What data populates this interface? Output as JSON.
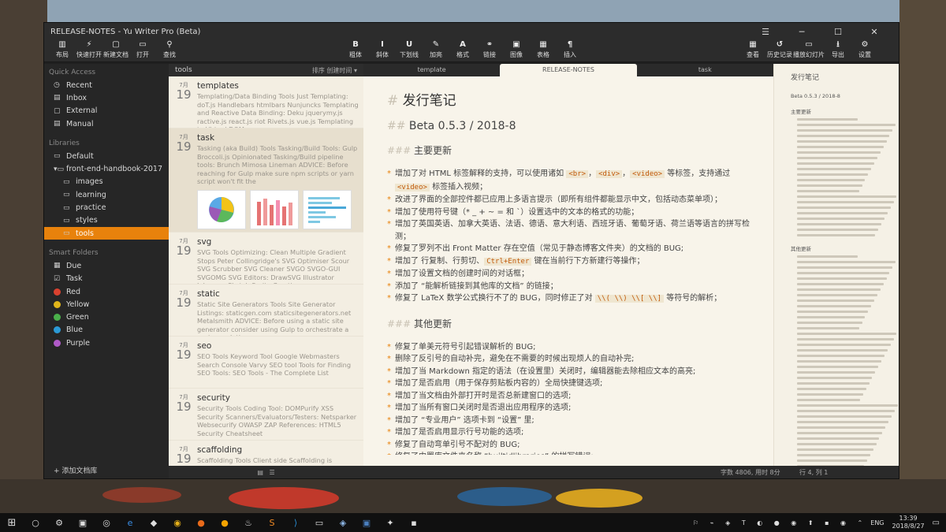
{
  "window": {
    "title": "RELEASE-NOTES - Yu Writer Pro (Beta)"
  },
  "toolbar": {
    "left": [
      {
        "icon": "layout-icon",
        "glyph": "▥",
        "label": "布局"
      },
      {
        "icon": "lightning-icon",
        "glyph": "⚡",
        "label": "快速打开"
      },
      {
        "icon": "new-doc-icon",
        "glyph": "▢",
        "label": "新建文档"
      },
      {
        "icon": "folder-icon",
        "glyph": "▭",
        "label": "打开"
      },
      {
        "icon": "search-icon",
        "glyph": "⚲",
        "label": "查找"
      }
    ],
    "center": [
      {
        "icon": "bold-icon",
        "glyph": "B",
        "label": "粗体"
      },
      {
        "icon": "italic-icon",
        "glyph": "I",
        "label": "斜体"
      },
      {
        "icon": "underline-icon",
        "glyph": "U",
        "label": "下划线"
      },
      {
        "icon": "brush-icon",
        "glyph": "✎",
        "label": "加亮"
      },
      {
        "icon": "format-icon",
        "glyph": "A",
        "label": "格式"
      },
      {
        "icon": "link-icon",
        "glyph": "⚭",
        "label": "链接"
      },
      {
        "icon": "image-icon",
        "glyph": "▣",
        "label": "图像"
      },
      {
        "icon": "table-icon",
        "glyph": "▦",
        "label": "表格"
      },
      {
        "icon": "paragraph-icon",
        "glyph": "¶",
        "label": "插入"
      }
    ],
    "right": [
      {
        "icon": "view-icon",
        "glyph": "▦",
        "label": "查看"
      },
      {
        "icon": "history-icon",
        "glyph": "↺",
        "label": "历史记录"
      },
      {
        "icon": "slides-icon",
        "glyph": "▭",
        "label": "播放幻灯片"
      },
      {
        "icon": "export-icon",
        "glyph": "⭳",
        "label": "导出"
      },
      {
        "icon": "gear-icon",
        "glyph": "⚙",
        "label": "设置"
      }
    ]
  },
  "sidebar": {
    "quick_access_title": "Quick Access",
    "quick": [
      {
        "icon": "clock-icon",
        "glyph": "◷",
        "label": "Recent"
      },
      {
        "icon": "inbox-icon",
        "glyph": "▤",
        "label": "Inbox"
      },
      {
        "icon": "external-icon",
        "glyph": "▢",
        "label": "External"
      },
      {
        "icon": "manual-icon",
        "glyph": "▤",
        "label": "Manual"
      }
    ],
    "libraries_title": "Libraries",
    "libs": [
      {
        "label": "Default",
        "sub": false,
        "active": false
      },
      {
        "label": "front-end-handbook-2017",
        "sub": false,
        "active": false
      },
      {
        "label": "images",
        "sub": true,
        "active": false
      },
      {
        "label": "learning",
        "sub": true,
        "active": false
      },
      {
        "label": "practice",
        "sub": true,
        "active": false
      },
      {
        "label": "styles",
        "sub": true,
        "active": false
      },
      {
        "label": "tools",
        "sub": true,
        "active": true
      }
    ],
    "smart_title": "Smart Folders",
    "smart": [
      {
        "label": "Due",
        "glyph": "▦"
      },
      {
        "label": "Task",
        "glyph": "☑"
      }
    ],
    "colors": [
      {
        "label": "Red",
        "color": "#d9412f"
      },
      {
        "label": "Yellow",
        "color": "#e0b51a"
      },
      {
        "label": "Green",
        "color": "#4ab04a"
      },
      {
        "label": "Blue",
        "color": "#2b9ad6"
      },
      {
        "label": "Purple",
        "color": "#b05ac8"
      }
    ],
    "add_library": "添加文档库"
  },
  "list": {
    "header": "tools",
    "sort": "排序 创建时间",
    "items": [
      {
        "month": "7月",
        "day": "19",
        "title": "templates",
        "desc": "Templating/Data Binding Tools Just Templating: doT.js Handlebars htmlbars Nunjuncks Templating and Reactive Data Binding: Deku jquerymy.js ractive.js react.js riot Rivets.js vue.js Templating to Virtual DOM:"
      },
      {
        "month": "7月",
        "day": "19",
        "title": "task",
        "desc": "Tasking (aka Build) Tools Tasking/Build Tools: Gulp Broccoli.js Opinionated Tasking/Build pipeline tools: Brunch Mimosa Lineman ADVICE: Before reaching for Gulp make sure npm scripts or yarn script won't fit the"
      },
      {
        "month": "7月",
        "day": "19",
        "title": "svg",
        "desc": "SVG Tools Optimizing: Clean Multiple Gradient Stops Peter Collingridge's SVG Optimiser Scour SVG Scrubber SVG Cleaner SVGO SVGO-GUI SVGOMG SVG Editors: DrawSVG Illustrator Inkscape Sketch Sprite Creation:"
      },
      {
        "month": "7月",
        "day": "19",
        "title": "static",
        "desc": "Static Site Generators Tools Site Generator Listings: staticgen.com staticsitegenerators.net Metalsmith ADVICE: Before using a static site generator consider using Gulp to orchestrate a custom solution or use a"
      },
      {
        "month": "7月",
        "day": "19",
        "title": "seo",
        "desc": "SEO Tools Keyword Tool Google Webmasters Search Console Varvy SEO tool Tools for Finding SEO Tools: SEO Tools - The Complete List"
      },
      {
        "month": "7月",
        "day": "19",
        "title": "security",
        "desc": "Security Tools Coding Tool: DOMPurify XSS Security Scanners/Evaluators/Testers: Netsparker Websecurify OWASP ZAP References: HTML5 Security Cheatsheet"
      },
      {
        "month": "7月",
        "day": "19",
        "title": "scaffolding",
        "desc": "Scaffolding Tools Client side Scaffolding is concerned with generating a starter template for the application as a whole, rather than generating code to access a"
      }
    ]
  },
  "tabs": [
    "template",
    "RELEASE-NOTES",
    "task"
  ],
  "doc": {
    "h1": "发行笔记",
    "h2": "Beta 0.5.3 / 2018-8",
    "h3a": "主要更新",
    "main": [
      {
        "t": "增加了对 HTML 标签解释的支持，可以使用诸如 ",
        "codes": [
          "<br>",
          "<div>",
          "<video>"
        ],
        "after": " 等标签，支持通过 ",
        "code2": "<video>",
        "end": " 标签插入视频；"
      },
      {
        "t": "改进了界面的全部控件都已应用上多语言提示（即所有组件都能显示中文，包括动态菜单项）；"
      },
      {
        "t": "增加了使用符号键（* _ + ~ = 和 `）设置选中的文本的格式的功能；"
      },
      {
        "t": "增加了英国英语、加拿大英语、法语、德语、意大利语、西班牙语、葡萄牙语、荷兰语等语言的拼写检测；"
      },
      {
        "t": "修复了罗列不出 Front Matter 存在空值（常见于静态博客文件夹）的文档的 BUG;"
      },
      {
        "t": "增加了 行复制、行剪切、",
        "code": "Ctrl+Enter",
        "end": " 键在当前行下方新建行等操作；"
      },
      {
        "t": "增加了设置文档的创建时间的对话框；"
      },
      {
        "t": "添加了 “能解析链接到其他库的文档” 的链接；"
      },
      {
        "t": "修复了 LaTeX 数学公式换行不了的 BUG，同时修正了对 ",
        "code": "\\\\( \\\\) \\\\[ \\\\]",
        "end": " 等符号的解析；"
      }
    ],
    "h3b": "其他更新",
    "other": [
      "修复了单美元符号引起错误解析的 BUG;",
      "删除了反引号的自动补完，避免在不需要的时候出现烦人的自动补完;",
      "增加了当 Markdown 指定的语法（在设置里）关闭时，编辑器能去除相应文本的高亮;",
      "增加了是否启用（用于保存剪贴板内容的）全局快捷键选项;",
      "增加了当文档由外部打开时是否总新建窗口的选项;",
      "增加了当所有窗口关闭时是否退出应用程序的选项;",
      "增加了 “专业用户” 选项卡到 “设置” 里;",
      "增加了是否启用显示行号功能的选项;",
      "修复了自动弯单引号不配对的 BUG;",
      "修复了内置库文件夹名称 “builtidlibraries” 的拼写错误;"
    ]
  },
  "outline": {
    "title": "发行笔记",
    "ver": "Beta 0.5.3 / 2018-8",
    "main": "主要更新",
    "other": "其他更新"
  },
  "status": {
    "words": "字数 4806, 用时 8分",
    "pos": "行 4, 列 1"
  },
  "taskbar": {
    "lang": "ENG",
    "time": "13:39",
    "date": "2018/8/27"
  }
}
